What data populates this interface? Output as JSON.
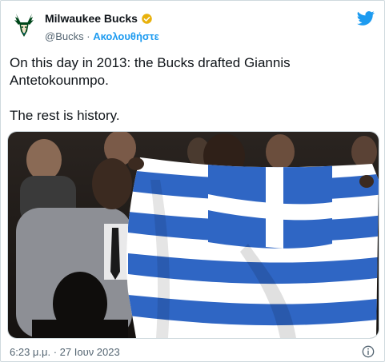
{
  "author": {
    "name": "Milwaukee Bucks",
    "handle": "@Bucks",
    "separator": "·",
    "follow_label": "Ακολουθήστε",
    "verified_color": "#e8b10c",
    "logo_color": "#00471b"
  },
  "tweet": {
    "line1": "On this day in 2013: the Bucks drafted Giannis Antetokounmpo.",
    "line2": "The rest is history."
  },
  "media": {
    "icon": "photo"
  },
  "footer": {
    "timestamp": "6:23 μ.μ. · 27 Ιουν 2023"
  },
  "colors": {
    "accent": "#1d9bf0",
    "text": "#0f1419",
    "secondary": "#536471"
  }
}
